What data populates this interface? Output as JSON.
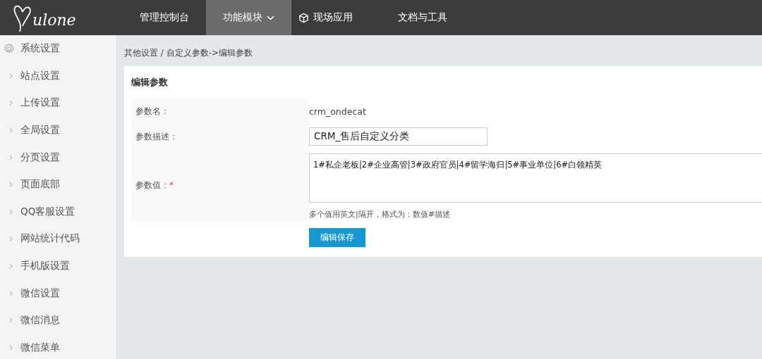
{
  "logo": {
    "text": "ulone"
  },
  "nav": [
    {
      "label": "管理控制台",
      "selected": false,
      "kind": "plain"
    },
    {
      "label": "功能模块",
      "selected": true,
      "kind": "dropdown"
    },
    {
      "label": "现场应用",
      "selected": false,
      "kind": "cube"
    },
    {
      "label": "文档与工具",
      "selected": false,
      "kind": "plain"
    }
  ],
  "sidebar": {
    "heading": "系统设置",
    "items": [
      "站点设置",
      "上传设置",
      "全局设置",
      "分页设置",
      "页面底部",
      "QQ客服设置",
      "网站统计代码",
      "手机版设置",
      "微信设置",
      "微信消息",
      "微信菜单"
    ]
  },
  "breadcrumb": "其他设置 / 自定义参数->编辑参数",
  "form": {
    "title": "编辑参数",
    "fields": [
      {
        "label": "参数名：",
        "kind": "static",
        "value": "crm_ondecat"
      },
      {
        "label": "参数描述：",
        "kind": "input",
        "value": "CRM_售后自定义分类"
      },
      {
        "label": "参数值：",
        "kind": "textarea",
        "value": "1#私企老板|2#企业高管|3#政府官员|4#留学海归|5#事业单位|6#白领精英",
        "required_mark": "*",
        "hint": "多个值用英文|隔开，格式为：数值#描述"
      }
    ],
    "submit": "编辑保存"
  }
}
